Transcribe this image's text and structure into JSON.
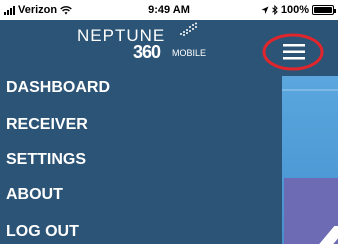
{
  "status_bar": {
    "carrier": "Verizon",
    "time": "9:49 AM",
    "battery": "100%"
  },
  "header": {
    "logo_word": "NEPTUNE",
    "logo_number": "360",
    "logo_suffix": "MOBILE"
  },
  "menu": {
    "items": [
      {
        "label": "DASHBOARD"
      },
      {
        "label": "RECEIVER"
      },
      {
        "label": "SETTINGS"
      },
      {
        "label": "ABOUT"
      },
      {
        "label": "LOG OUT"
      }
    ]
  },
  "colors": {
    "drawer_bg": "#2c5476",
    "highlight_circle": "#e0262c",
    "content_blue": "#5aa6dd"
  },
  "icons": {
    "menu_toggle": "hamburger-icon",
    "location": "location-arrow-icon",
    "bluetooth": "bluetooth-icon",
    "wifi": "wifi-icon"
  }
}
